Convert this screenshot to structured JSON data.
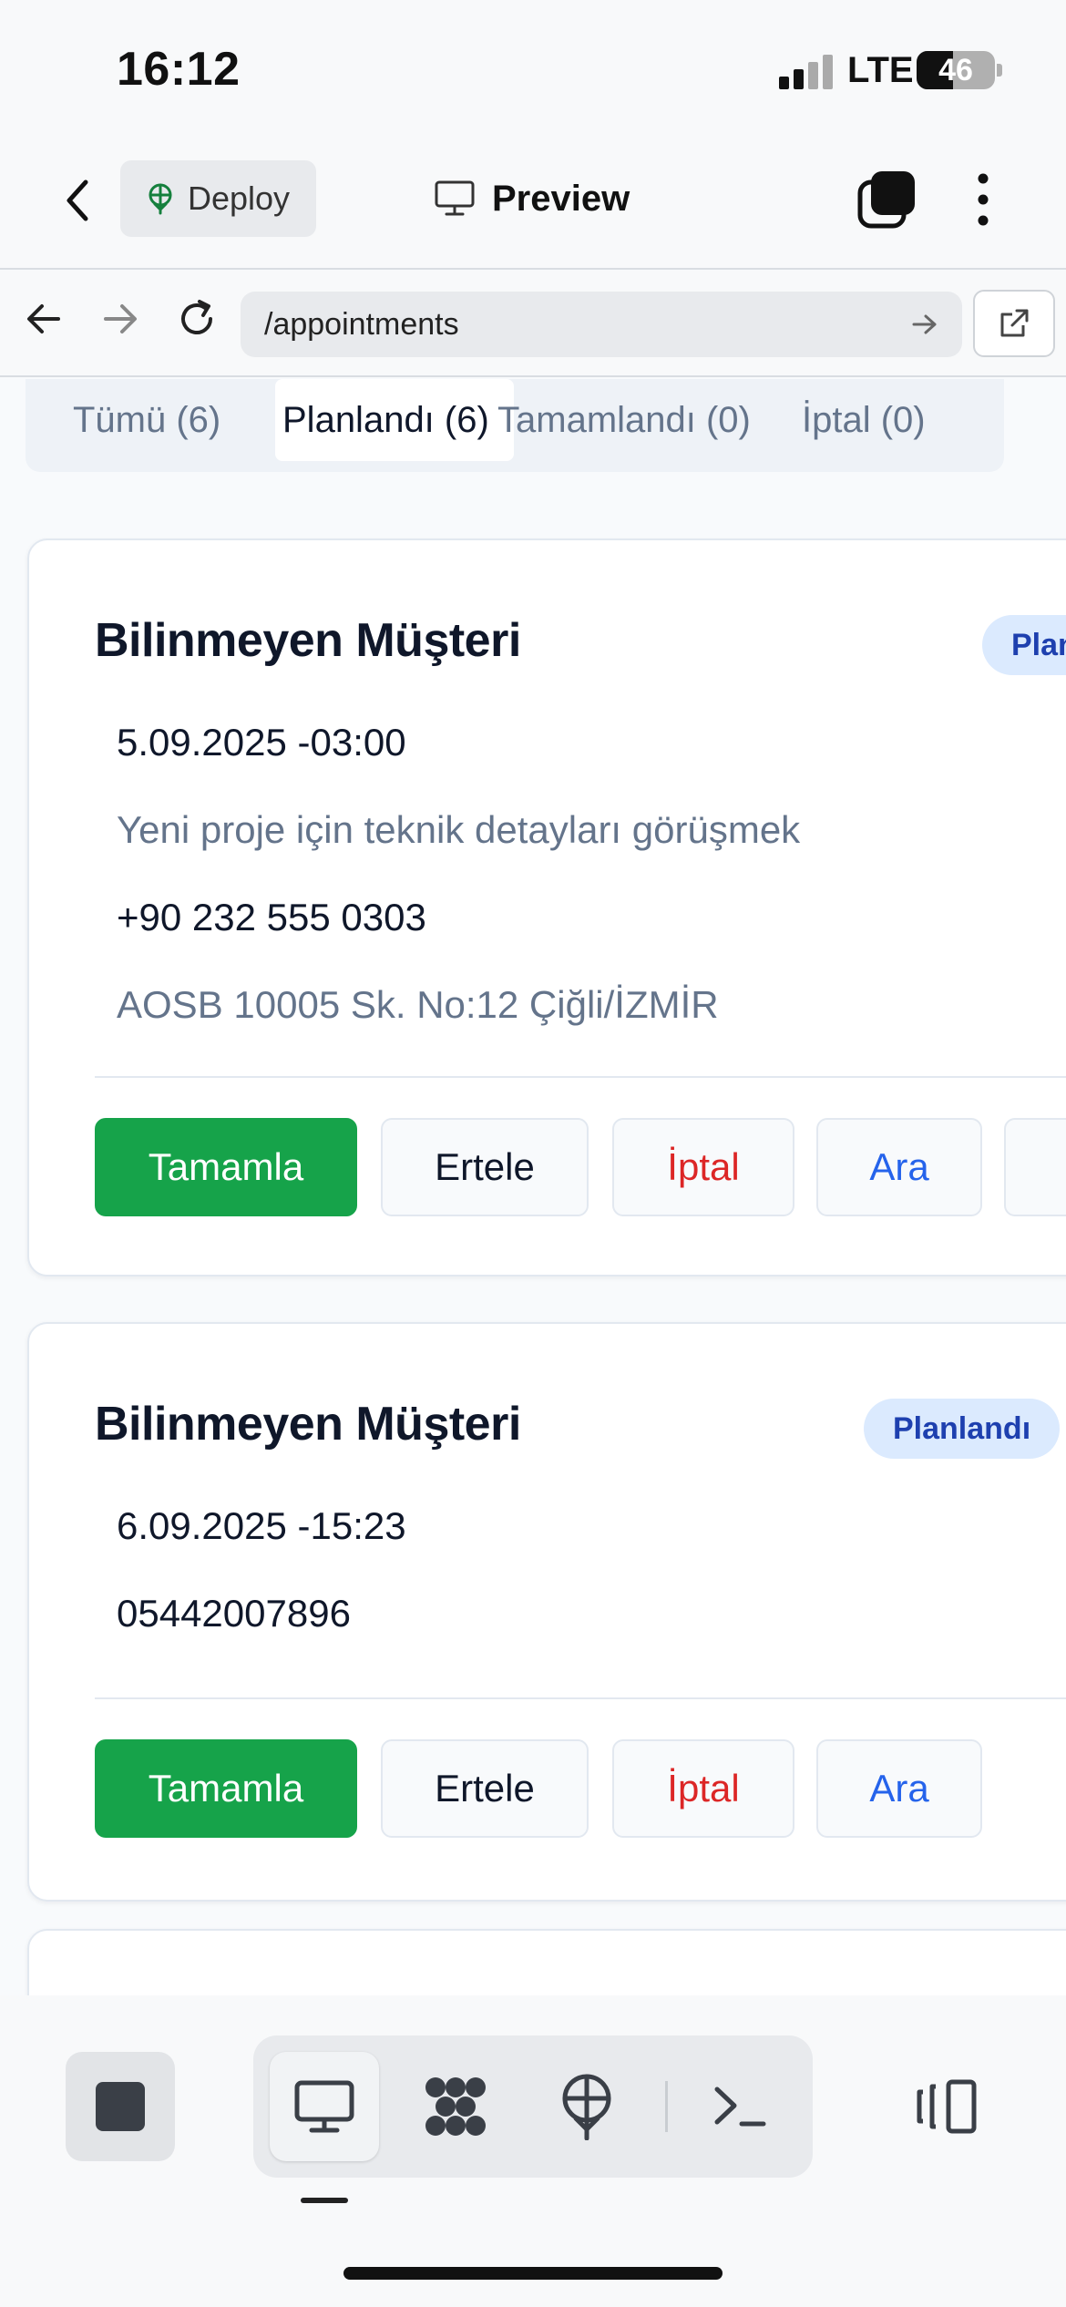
{
  "status_bar": {
    "time": "16:12",
    "network": "LTE",
    "battery": "46",
    "battery_level": 0.46
  },
  "header": {
    "deploy_label": "Deploy",
    "title": "Preview"
  },
  "browser": {
    "url": "/appointments"
  },
  "filter_tabs": [
    {
      "label": "Tümü (6)",
      "active": false
    },
    {
      "label": "Planlandı (6)",
      "active": true
    },
    {
      "label": "Tamamlandı (0)",
      "active": false
    },
    {
      "label": "İptal (0)",
      "active": false
    }
  ],
  "appointments": [
    {
      "customer": "Bilinmeyen Müşteri",
      "status": "Planlandı",
      "datetime": "5.09.2025 -03:00",
      "note": "Yeni proje için teknik detayları görüşmek",
      "phone": "+90 232 555 0303",
      "address": "AOSB 10005 Sk. No:12 Çiğli/İZMİR"
    },
    {
      "customer": "Bilinmeyen Müşteri",
      "status": "Planlandı",
      "datetime": "6.09.2025 -15:23",
      "phone": "05442007896"
    }
  ],
  "actions": {
    "complete": "Tamamla",
    "postpone": "Ertele",
    "cancel": "İptal",
    "call": "Ara"
  },
  "colors": {
    "success": "#16a34a",
    "danger": "#dc2626",
    "link": "#2563eb",
    "badge_bg": "#dbeafe",
    "badge_text": "#1e40af"
  },
  "toolbar": {
    "icons": [
      "stop-icon",
      "monitor-icon",
      "workflow-icon",
      "deploy-icon",
      "terminal-icon",
      "split-view-icon"
    ]
  }
}
